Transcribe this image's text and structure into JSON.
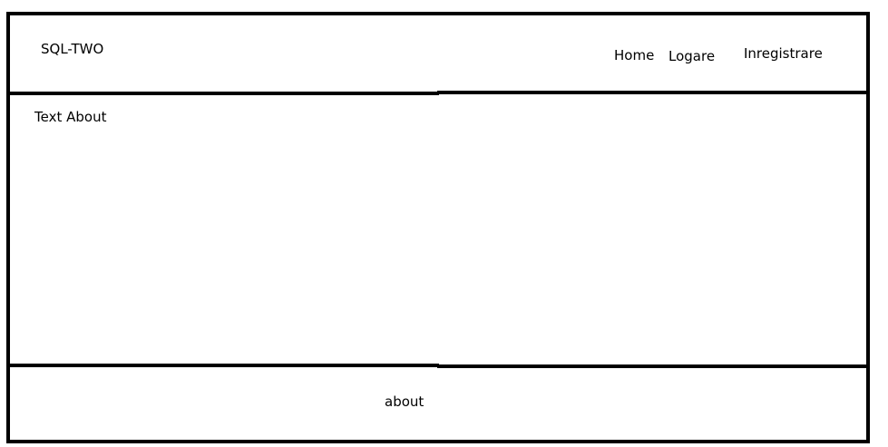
{
  "header": {
    "brand": "SQL-TWO",
    "nav": {
      "home": "Home",
      "login": "Logare",
      "register": "Inregistrare"
    }
  },
  "main": {
    "text": "Text About"
  },
  "footer": {
    "text": "about"
  }
}
